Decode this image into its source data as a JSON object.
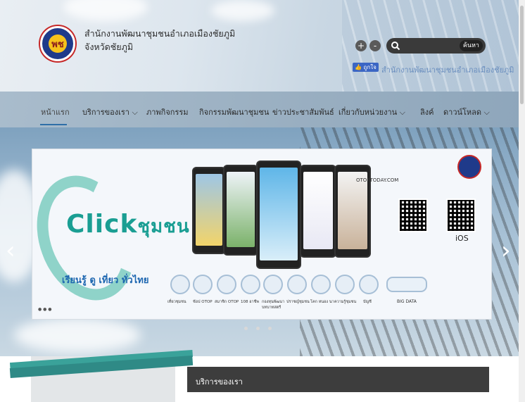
{
  "header": {
    "title": "สำนักงานพัฒนาชุมชนอำเภอเมืองชัยภูมิ",
    "subtitle": "จังหวัดชัยภูมิ",
    "zoom_in": "+",
    "zoom_out": "-",
    "search_placeholder": "",
    "search_button": "ค้นหา",
    "fb_badge": "👍 ถูกใจ",
    "fb_page": "สำนักงานพัฒนาชุมชนอำเภอเมืองชัยภูมิ"
  },
  "nav": {
    "items": [
      {
        "label": "หน้าแรก"
      },
      {
        "label": "บริการของเรา ⌵"
      },
      {
        "label": "ภาพกิจกรรม"
      },
      {
        "label": "กิจกรรมพัฒนาชุมชน"
      },
      {
        "label": "ข่าวประชาสัมพันธ์"
      },
      {
        "label": "เกี่ยวกับหน่วยงาน ⌵"
      },
      {
        "label": "ลิงค์"
      },
      {
        "label": "ดาวน์โหลด ⌵"
      }
    ]
  },
  "banner": {
    "brand": "Click",
    "brand_thai": "ชุมชน",
    "slogan": "เรียนรู้ ดู เที่ยว ทั่วไทย",
    "web_label": "OTOPTODAY.COM",
    "ios_label": "iOS",
    "bigdata": "BIG DATA",
    "icons": [
      {
        "label": "เที่ยวชุมชน"
      },
      {
        "label": "ช้อป OTOP"
      },
      {
        "label": "สมาชิก OTOP"
      },
      {
        "label": "108 อาชีพ"
      },
      {
        "label": "กองทุนพัฒนาบทบาทสตรี"
      },
      {
        "label": "ปราชญ์ชุมชน"
      },
      {
        "label": "โคก หนอง นา"
      },
      {
        "label": "ความรู้ชุมชน"
      },
      {
        "label": "บัญชี"
      }
    ]
  },
  "slider": {
    "prev": "‹",
    "next": "›"
  },
  "section": {
    "services_title": "บริการของเรา"
  },
  "colors": {
    "accent": "#2f6fa8",
    "teal": "#1a9e93",
    "dark_bar": "#3d3d3d"
  }
}
